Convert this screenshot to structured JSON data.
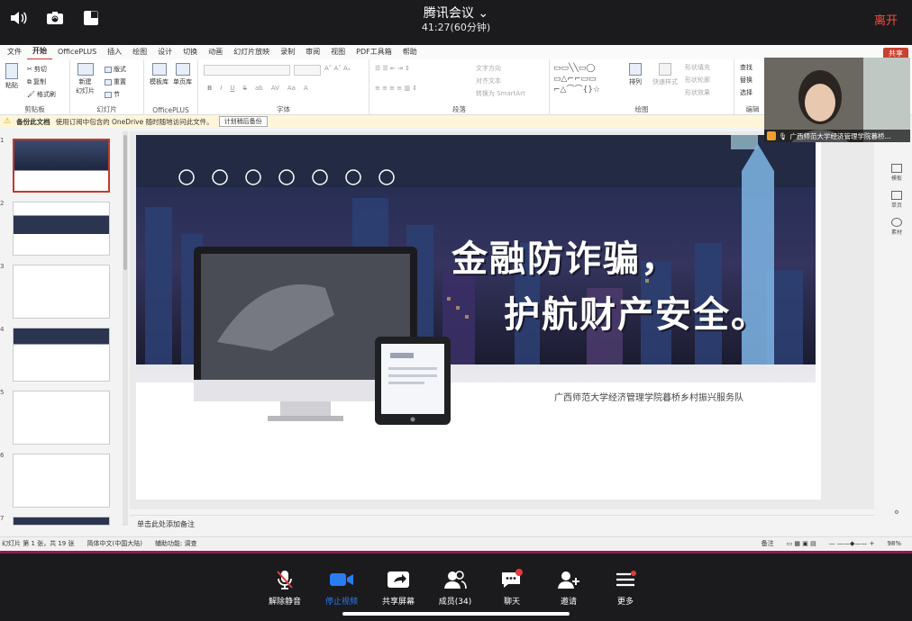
{
  "meeting": {
    "title": "腾讯会议",
    "elapsed": "41:27(60分钟)",
    "leave": "离开"
  },
  "ribbon_tabs": [
    "文件",
    "开始",
    "OfficePLUS",
    "插入",
    "绘图",
    "设计",
    "切换",
    "动画",
    "幻灯片放映",
    "录制",
    "审阅",
    "视图",
    "PDF工具箱",
    "帮助"
  ],
  "share_label": "共享",
  "ribbon": {
    "clipboard": {
      "paste": "粘贴",
      "cut": "剪切",
      "copy": "复制",
      "format_painter": "格式刷",
      "label": "剪贴板"
    },
    "slides": {
      "new_slide": "新建\n幻灯片",
      "layout": "版式",
      "reset": "重置",
      "section": "节",
      "label": "幻灯片"
    },
    "officeplus": {
      "template": "模板库",
      "single": "单页库",
      "label": "OfficePLUS"
    },
    "font": {
      "label": "字体"
    },
    "paragraph": {
      "text_direction": "文字方向",
      "align_text": "对齐文本",
      "smartart": "转换为 SmartArt",
      "label": "段落"
    },
    "drawing": {
      "arrange": "排列",
      "quick_styles": "快速样式",
      "fill": "形状填充",
      "outline": "形状轮廓",
      "effects": "形状效果",
      "label": "绘图"
    },
    "editing": {
      "find": "查找",
      "replace": "替换",
      "select": "选择",
      "label": "编辑"
    }
  },
  "notice": {
    "title": "备份此文档",
    "text": "使用订阅中包含的 OneDrive 随时随地访问此文件。",
    "button": "计划稍后备份"
  },
  "thumbnails": [
    "1",
    "2",
    "3",
    "4",
    "5",
    "6",
    "7"
  ],
  "slide": {
    "title_line1": "金融防诈骗，",
    "title_line2": "护航财产安全。",
    "subtitle": "广西师范大学经济管理学院暮桥乡村振兴服务队"
  },
  "notes_placeholder": "单击此处添加备注",
  "status": {
    "slide_count": "幻灯片 第 1 张，共 19 张",
    "language": "简体中文(中国大陆)",
    "accessibility": "辅助功能: 调查",
    "notes": "备注",
    "zoom": "98%"
  },
  "right_pane": [
    "模板",
    "单页",
    "素材"
  ],
  "video": {
    "name": "广西师范大学经济管理学院暮桥..."
  },
  "toolbar": [
    {
      "label": "解除静音",
      "icon": "muted-mic-icon"
    },
    {
      "label": "停止视频",
      "icon": "video-camera-icon"
    },
    {
      "label": "共享屏幕",
      "icon": "share-screen-icon"
    },
    {
      "label": "成员(34)",
      "icon": "members-icon"
    },
    {
      "label": "聊天",
      "icon": "chat-icon"
    },
    {
      "label": "邀请",
      "icon": "invite-icon"
    },
    {
      "label": "更多",
      "icon": "more-icon"
    }
  ],
  "colors": {
    "accent": "#c23a2b",
    "leave": "#ff4a3d",
    "video_blue": "#2a7cf5",
    "bottom_border": "#8c1f4e"
  }
}
